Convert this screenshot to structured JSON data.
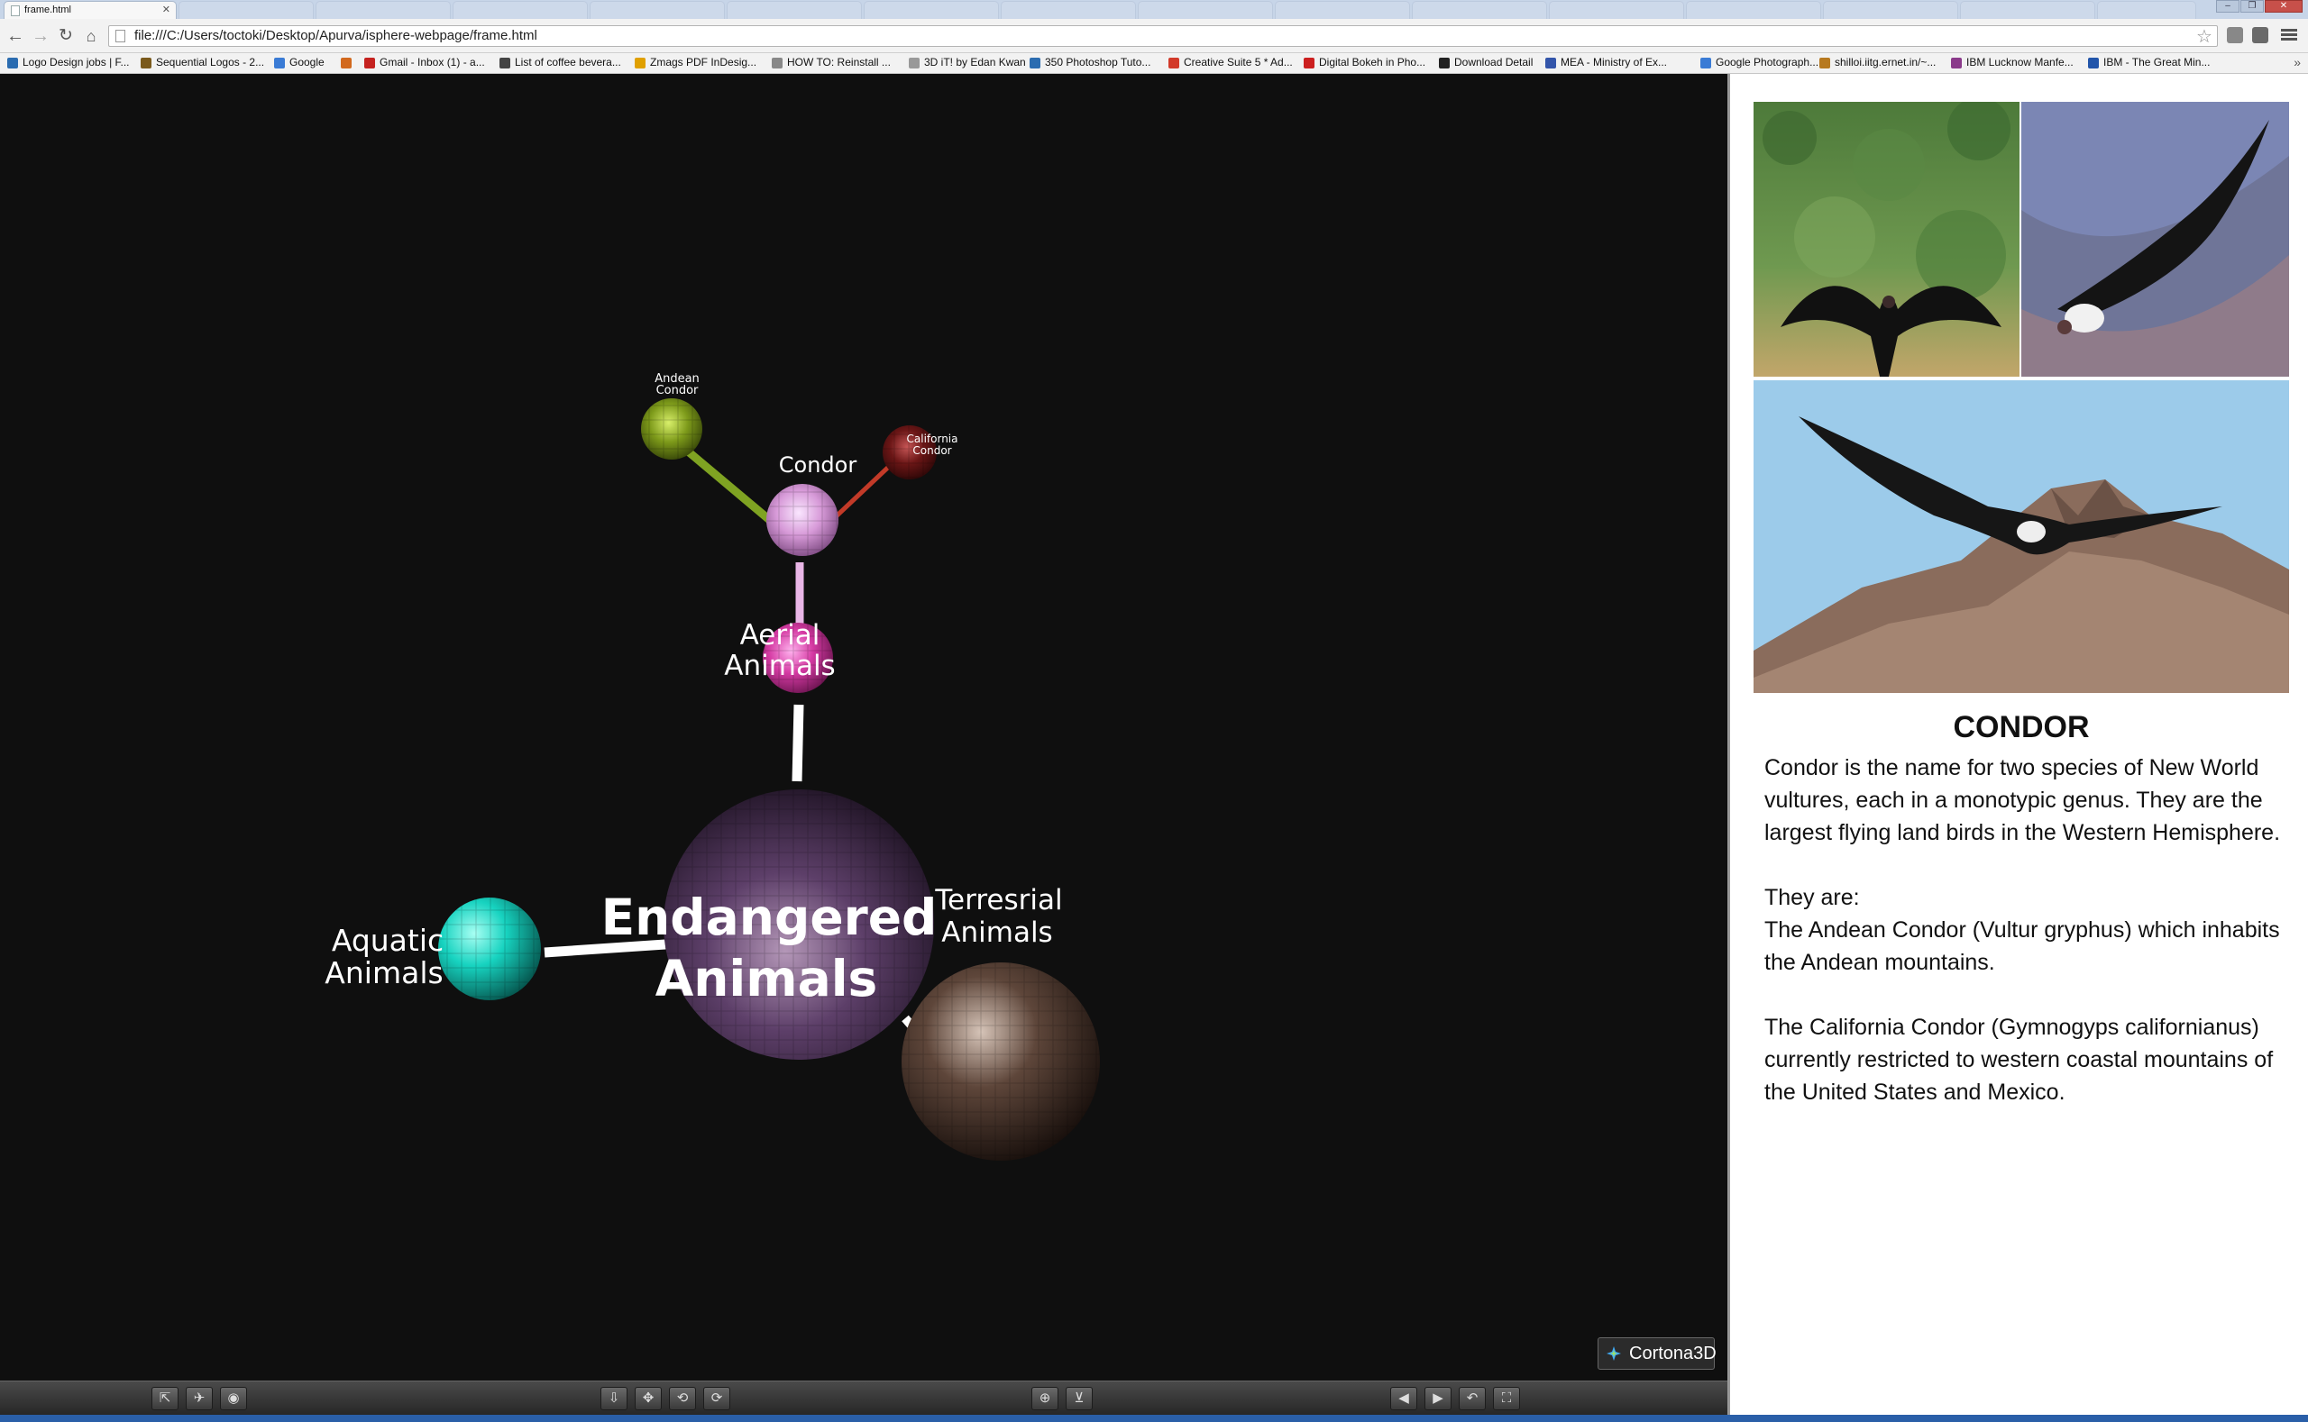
{
  "browser": {
    "active_tab_title": "frame.html",
    "address": "file:///C:/Users/toctoki/Desktop/Apurva/isphere-webpage/frame.html",
    "bookmarks": [
      {
        "label": "Logo Design jobs | F...",
        "color": "#2b6cb0"
      },
      {
        "label": "Sequential Logos - 2...",
        "color": "#7a5a1c"
      },
      {
        "label": "Google",
        "color": "#3a7bd5"
      },
      {
        "label": "",
        "color": "#d2691e"
      },
      {
        "label": "Gmail - Inbox (1) - a...",
        "color": "#c5221f"
      },
      {
        "label": "List of coffee bevera...",
        "color": "#444444"
      },
      {
        "label": "Zmags PDF InDesig...",
        "color": "#e0a000"
      },
      {
        "label": "HOW TO: Reinstall ...",
        "color": "#888888"
      },
      {
        "label": "3D iT! by Edan Kwan",
        "color": "#999999"
      },
      {
        "label": "350 Photoshop Tuto...",
        "color": "#2b6cb0"
      },
      {
        "label": "Creative Suite 5 * Ad...",
        "color": "#d23a2a"
      },
      {
        "label": "Digital Bokeh in Pho...",
        "color": "#cc1f1f"
      },
      {
        "label": "Download Detail",
        "color": "#222222"
      },
      {
        "label": "MEA - Ministry of Ex...",
        "color": "#3355aa"
      },
      {
        "label": "Google Photograph...",
        "color": "#3a7bd5"
      },
      {
        "label": "shilloi.iitg.ernet.in/~...",
        "color": "#b7791f"
      },
      {
        "label": "IBM Lucknow Manfe...",
        "color": "#8a3a8a"
      },
      {
        "label": "IBM - The Great Min...",
        "color": "#2255aa"
      }
    ]
  },
  "scene": {
    "nodes": {
      "root": {
        "label_line1": "Endangered",
        "label_line2": "Animals",
        "color": "#5c3d66"
      },
      "aquatic": {
        "label_line1": "Aquatic",
        "label_line2": "Animals",
        "color": "#19d8c6"
      },
      "terrestrial": {
        "label_line1": "Terresrial",
        "label_line2": "Animals",
        "color": "#5a4236"
      },
      "aerial": {
        "label_line1": "Aerial",
        "label_line2": "Animals",
        "color": "#d53aa3"
      },
      "condor": {
        "label": "Condor",
        "color": "#d79ad8"
      },
      "andean": {
        "label_line1": "Andean",
        "label_line2": "Condor",
        "color": "#7d9a1a"
      },
      "california": {
        "label_line1": "California",
        "label_line2": "Condor",
        "color": "#6b1616"
      }
    },
    "branding": "Cortona3D"
  },
  "player_icons": [
    "walk-icon",
    "fly-icon",
    "view-icon",
    "move-icon",
    "pan-icon",
    "rotate-icon",
    "spin-icon",
    "fit-icon",
    "align-icon",
    "prev-viewpoint-icon",
    "next-viewpoint-icon",
    "restore-icon",
    "fullscreen-icon"
  ],
  "info": {
    "title": "CONDOR",
    "paragraph1": "Condor is the name for two species of New World vultures, each in a monotypic genus. They are the largest flying land birds in the Western Hemisphere.",
    "they_are": "They are:",
    "andean": "The Andean Condor (Vultur gryphus) which inhabits the Andean mountains.",
    "california": "The California Condor (Gymnogyps californianus) currently restricted to western coastal mountains of the United States and Mexico."
  }
}
